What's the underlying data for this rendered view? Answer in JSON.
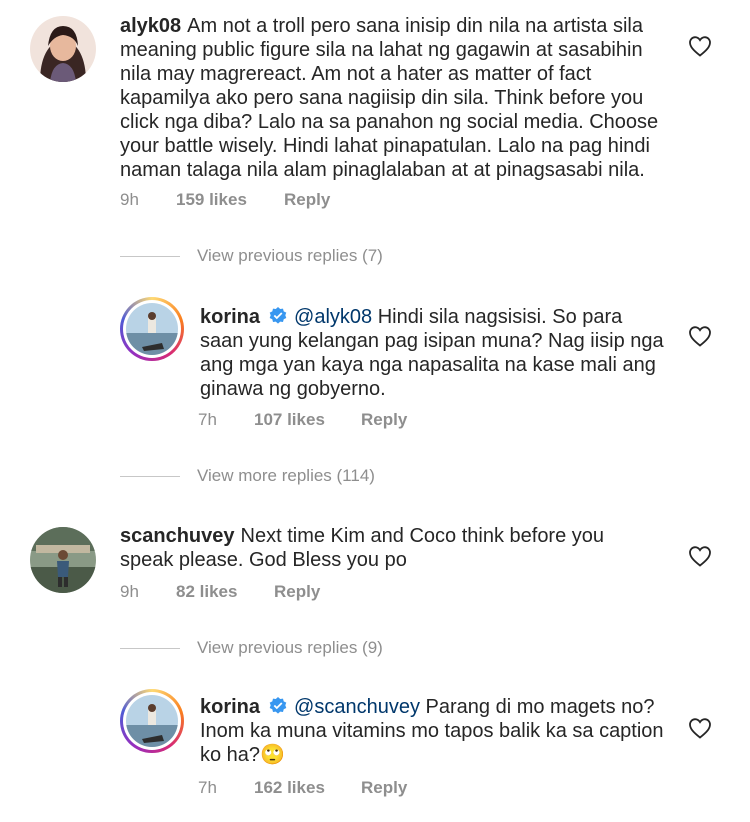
{
  "comments": [
    {
      "username": "alyk08",
      "text": "Am not a troll pero sana inisip din nila na artista sila meaning public figure sila na lahat ng gagawin at sasabihin nila may magrereact. Am not a hater as matter of fact kapamilya ako pero sana nagiisip din sila. Think before you click nga diba? Lalo na sa panahon ng social media. Choose your battle wisely. Hindi lahat pinapatulan. Lalo na pag hindi naman talaga nila alam pinaglalaban at at pinagsasabi nila.",
      "time": "9h",
      "likes": "159 likes",
      "reply": "Reply"
    },
    {
      "username": "korina",
      "mention": "@alyk08",
      "text": "Hindi sila nagsisisi. So para saan yung kelangan pag isipan muna? Nag iisip nga ang mga yan kaya nga napasalita na kase mali ang ginawa ng gobyerno.",
      "time": "7h",
      "likes": "107 likes",
      "reply": "Reply"
    },
    {
      "username": "scanchuvey",
      "text": "Next time Kim and Coco think before you speak please. God Bless you po",
      "time": "9h",
      "likes": "82 likes",
      "reply": "Reply"
    },
    {
      "username": "korina",
      "mention": "@scanchuvey",
      "text": "Parang di mo magets no? Inom ka muna vitamins mo tapos balik ka sa caption ko ha?🙄",
      "time": "7h",
      "likes": "162 likes",
      "reply": "Reply"
    }
  ],
  "reply_toggles": [
    "View previous replies (7)",
    "View more replies (114)",
    "View previous replies (9)"
  ],
  "colors": {
    "text": "#262626",
    "meta": "#8e8e8e",
    "mention": "#00376b",
    "verified": "#3897f0"
  },
  "icons": [
    "heart-icon",
    "verified-badge-icon"
  ]
}
